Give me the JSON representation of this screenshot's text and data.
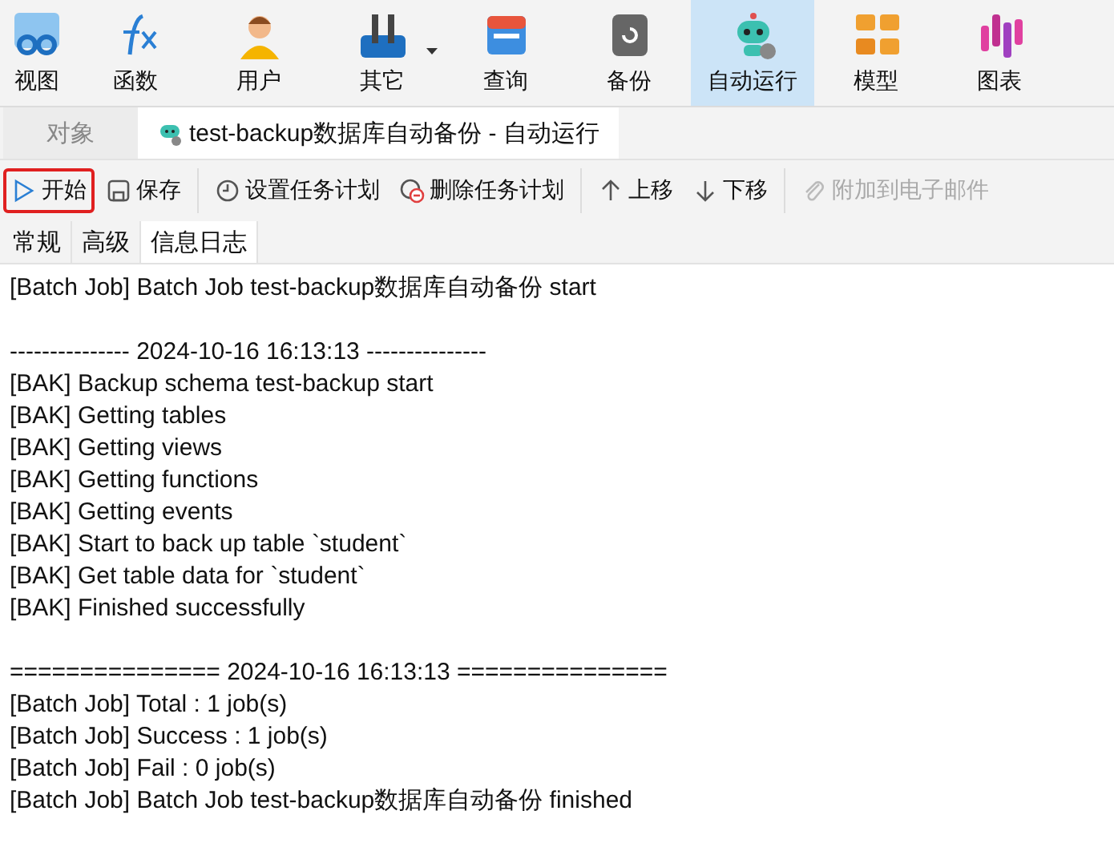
{
  "ribbon": [
    {
      "label": "视图",
      "selected": false
    },
    {
      "label": "函数",
      "selected": false
    },
    {
      "label": "用户",
      "selected": false
    },
    {
      "label": "其它",
      "selected": false,
      "dropdown": true
    },
    {
      "label": "查询",
      "selected": false
    },
    {
      "label": "备份",
      "selected": false
    },
    {
      "label": "自动运行",
      "selected": true
    },
    {
      "label": "模型",
      "selected": false
    },
    {
      "label": "图表",
      "selected": false
    }
  ],
  "tabs": [
    {
      "label": "对象",
      "selected": false
    },
    {
      "label": "test-backup数据库自动备份 - 自动运行",
      "selected": true
    }
  ],
  "actions": [
    {
      "kind": "button",
      "label": "开始",
      "disabled": false,
      "highlighted": true
    },
    {
      "kind": "button",
      "label": "保存",
      "disabled": false,
      "highlighted": false
    },
    {
      "kind": "separator"
    },
    {
      "kind": "button",
      "label": "设置任务计划",
      "disabled": false,
      "highlighted": false
    },
    {
      "kind": "button",
      "label": "删除任务计划",
      "disabled": false,
      "highlighted": false
    },
    {
      "kind": "separator"
    },
    {
      "kind": "button",
      "label": "上移",
      "disabled": false,
      "highlighted": false
    },
    {
      "kind": "button",
      "label": "下移",
      "disabled": false,
      "highlighted": false
    },
    {
      "kind": "separator"
    },
    {
      "kind": "button",
      "label": "附加到电子邮件",
      "disabled": true,
      "highlighted": false
    }
  ],
  "subtabs": [
    {
      "label": "常规",
      "selected": false
    },
    {
      "label": "高级",
      "selected": false
    },
    {
      "label": "信息日志",
      "selected": true
    }
  ],
  "log": [
    [
      "[Batch Job] Batch Job test-backup数据库自动备份 start"
    ],
    [
      "--------------- 2024-10-16 16:13:13 ---------------",
      "[BAK] Backup schema test-backup start",
      "[BAK] Getting tables",
      "[BAK] Getting views",
      "[BAK] Getting functions",
      "[BAK] Getting events",
      "[BAK] Start to back up table `student`",
      "[BAK] Get table data for `student`",
      "[BAK] Finished successfully"
    ],
    [
      "=============== 2024-10-16 16:13:13 ===============",
      "[Batch Job] Total : 1 job(s)",
      "[Batch Job] Success : 1 job(s)",
      "[Batch Job] Fail : 0 job(s)",
      "[Batch Job] Batch Job test-backup数据库自动备份 finished"
    ]
  ]
}
